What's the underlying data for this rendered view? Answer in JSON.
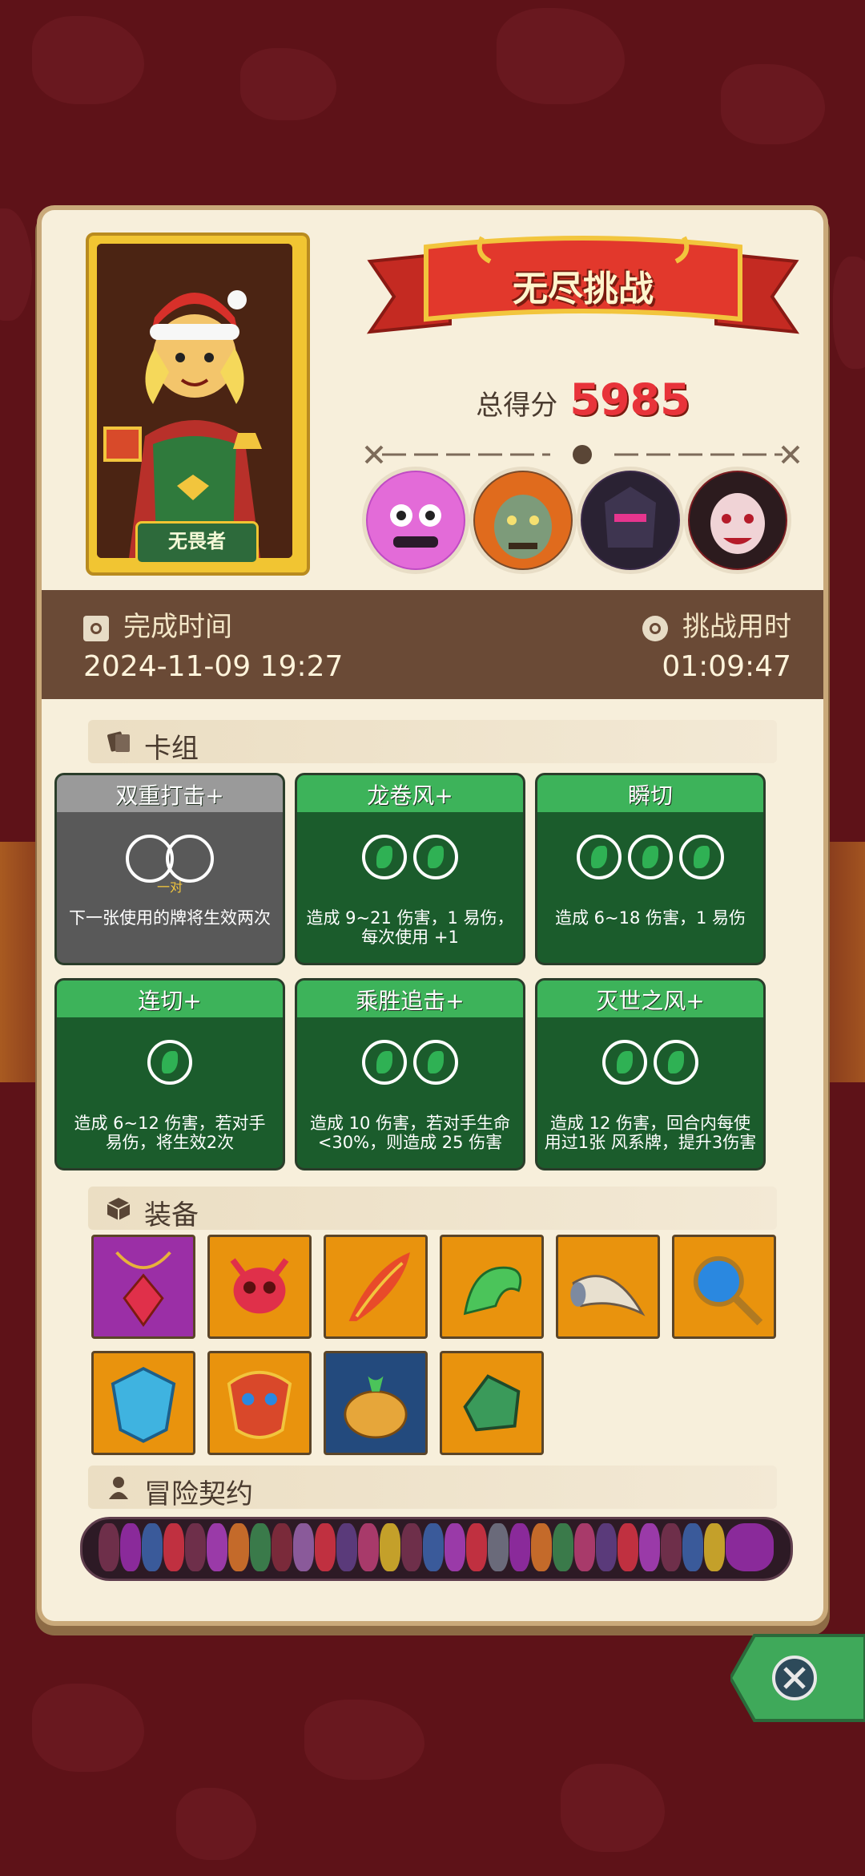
{
  "hero": {
    "rank_label": "无畏者"
  },
  "challenge": {
    "title": "无尽挑战",
    "score_label": "总得分",
    "score": "5985"
  },
  "enemies": [
    {
      "name": "purple-demon"
    },
    {
      "name": "orange-troll"
    },
    {
      "name": "dark-knight"
    },
    {
      "name": "vampire"
    }
  ],
  "info": {
    "finish_time_label": "完成时间",
    "finish_time": "2024-11-09 19:27",
    "duration_label": "挑战用时",
    "duration": "01:09:47"
  },
  "deck": {
    "section_label": "卡组",
    "cards": [
      {
        "name": "双重打击+",
        "style": "grey",
        "gems": 0,
        "sub": "一对",
        "desc": "下一张使用的牌将生效两次"
      },
      {
        "name": "龙卷风+",
        "style": "green",
        "gems": 2,
        "sub": "",
        "desc": "造成 9~21 伤害，1 易伤，每次使用 +1"
      },
      {
        "name": "瞬切",
        "style": "green",
        "gems": 3,
        "sub": "",
        "desc": "造成 6~18 伤害，1 易伤"
      },
      {
        "name": "连切+",
        "style": "green",
        "gems": 1,
        "sub": "",
        "desc": "造成 6~12 伤害，若对手 易伤，将生效2次"
      },
      {
        "name": "乘胜追击+",
        "style": "green",
        "gems": 2,
        "sub": "",
        "desc": "造成 10 伤害，若对手生命<30%，则造成 25 伤害"
      },
      {
        "name": "灭世之风+",
        "style": "green",
        "gems": 2,
        "sub": "",
        "desc": "造成 12 伤害，回合内每使用过1张 风系牌，提升3伤害"
      }
    ]
  },
  "equipment": {
    "section_label": "装备",
    "items": [
      {
        "icon": "red-gem-necklace-icon",
        "bg": "#9b2fa6"
      },
      {
        "icon": "demon-skull-icon",
        "bg": "#e9930d"
      },
      {
        "icon": "flame-feather-icon",
        "bg": "#e9930d"
      },
      {
        "icon": "green-dragon-icon",
        "bg": "#e9930d"
      },
      {
        "icon": "horn-icon",
        "bg": "#e9930d"
      },
      {
        "icon": "blue-orb-staff-icon",
        "bg": "#e9930d"
      },
      {
        "icon": "blue-crystal-shield-icon",
        "bg": "#e9930d"
      },
      {
        "icon": "tribal-mask-icon",
        "bg": "#e9930d"
      },
      {
        "icon": "golden-pot-icon",
        "bg": "#234a7d"
      },
      {
        "icon": "green-stone-icon",
        "bg": "#e9930d"
      }
    ]
  },
  "contracts": {
    "section_label": "冒险契约"
  },
  "colors": {
    "accent": "#e8333a",
    "band": "#6a4a36",
    "paper": "#f7efdb"
  }
}
